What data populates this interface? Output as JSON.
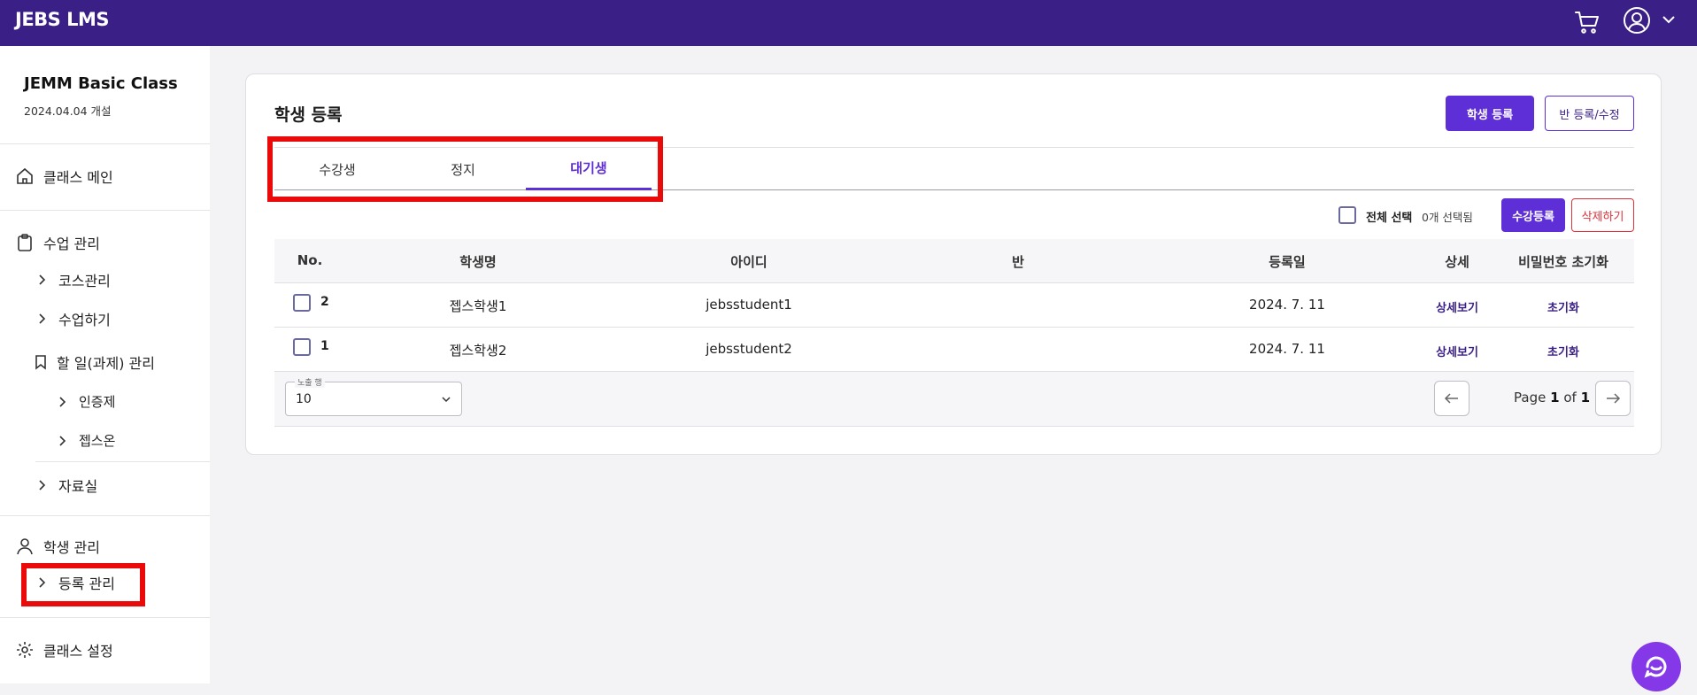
{
  "header": {
    "brand": "JEBS LMS",
    "icons": [
      "cart-icon",
      "user-icon",
      "chevron-down-icon"
    ]
  },
  "sidebar": {
    "class_title": "JEMM Basic Class",
    "class_date": "2024.04.04 개설",
    "class_main": "클래스 메인",
    "lesson_mgmt": "수업 관리",
    "course_mgmt": "코스관리",
    "do_lesson": "수업하기",
    "todo_mgmt": "할 일(과제) 관리",
    "certification": "인증제",
    "jebson": "젭스온",
    "library": "자료실",
    "student_mgmt": "학생 관리",
    "enroll_mgmt": "등록 관리",
    "class_settings": "클래스 설정"
  },
  "main": {
    "title": "학생 등록",
    "register_button": "학생 등록",
    "class_edit_button": "반 등록/수정",
    "tabs": [
      "수강생",
      "정지",
      "대기생"
    ],
    "active_tab": "대기생",
    "select_all_label": "전체 선택",
    "selected_count": "0개 선택됨",
    "enroll_button": "수강등록",
    "delete_button": "삭제하기",
    "columns": [
      "No.",
      "학생명",
      "아이디",
      "반",
      "등록일",
      "상세",
      "비밀번호 초기화"
    ],
    "rows": [
      {
        "no": "2",
        "name": "젭스학생1",
        "id": "jebsstudent1",
        "class": "",
        "date": "2024. 7. 11",
        "detail": "상세보기",
        "reset": "초기화"
      },
      {
        "no": "1",
        "name": "젭스학생2",
        "id": "jebsstudent2",
        "class": "",
        "date": "2024. 7. 11",
        "detail": "상세보기",
        "reset": "초기화"
      }
    ],
    "rows_select_label": "노출 행",
    "rows_select_value": "10",
    "page_prefix": "Page",
    "page_current": "1",
    "page_of": "of",
    "page_total": "1"
  },
  "colors": {
    "brand": "#3a1f86",
    "accent": "#5e2ed6",
    "danger": "#e2303a",
    "annotation": "#ea0a0a"
  }
}
